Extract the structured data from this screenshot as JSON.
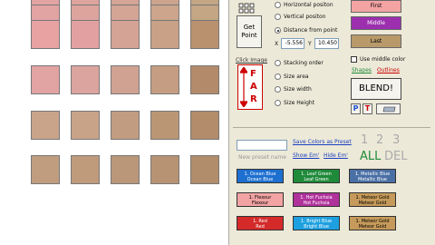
{
  "swatches": {
    "columns": 5,
    "colors": [
      [
        "#e2a3a3",
        "#dda49e",
        "#d4a495",
        "#cca58c",
        "#c4a584"
      ],
      [
        "#e8a2a2",
        "#e2a1a0",
        "#d4a395",
        "#c8a187",
        "#b9916e"
      ],
      [
        "#e2a3a3",
        "#dca49e",
        "#cfa292",
        "#c59d82",
        "#b38b6b"
      ],
      [
        "#c9a48a",
        "#c9a388",
        "#c29c80",
        "#bb9675",
        "#b38c6b"
      ],
      [
        "#c09d7f",
        "#bf9b7c",
        "#bb977a",
        "#b79373",
        "#b28d6c"
      ]
    ]
  },
  "panel": {
    "get_point_line1": "Get",
    "get_point_line2": "Point",
    "click_image_label": "Click Image",
    "far_letters": [
      "F",
      "A",
      "R"
    ],
    "radio_options": [
      {
        "label": "Horizontal positon",
        "selected": false
      },
      {
        "label": "Vertical positon",
        "selected": false
      },
      {
        "label": "Distance from point",
        "selected": true
      }
    ],
    "x_label": "X",
    "x_value": "-5.556",
    "y_label": "Y",
    "y_value": "10.450",
    "radio_options2": [
      {
        "label": "Stacking order",
        "selected": false
      },
      {
        "label": "Size area",
        "selected": false
      },
      {
        "label": "Size width",
        "selected": false
      },
      {
        "label": "Size Height",
        "selected": false
      }
    ],
    "first_label": "First",
    "middle_label": "Middle",
    "last_label": "Last",
    "use_middle_color": "Use middle color",
    "shapes_label": "Shapes",
    "outlines_label": "Outlines",
    "blend_label": "BLEND!",
    "p_label": "P",
    "t_label": "T",
    "save_colors_label": "Save Colors as Preset",
    "new_preset_placeholder": "New preset name",
    "show_em": "Show Em'",
    "hide_em": "Hide Em'",
    "num_1": "1",
    "num_2": "2",
    "num_3": "3",
    "all_label": "ALL",
    "del_label": "DEL",
    "colors": {
      "first": "#f4a3a3",
      "middle": "#9b2fae",
      "last": "#b89a6a",
      "accent": "#cc0000"
    }
  },
  "presets": [
    [
      {
        "l1": "1. Ocean Blue",
        "l2": "Ocean Blue",
        "color": "#1d6fd0",
        "dark": false
      },
      {
        "l1": "1. Leaf Green",
        "l2": "Leaf Green",
        "color": "#1f8a3a",
        "dark": false
      },
      {
        "l1": "1. Metallic Blue",
        "l2": "Metallic Blue",
        "color": "#4a6fa5",
        "dark": false
      }
    ],
    [
      {
        "l1": "1. Flexour",
        "l2": "Flexour",
        "color": "#f2a3a3",
        "dark": true
      },
      {
        "l1": "1. Hot Fuchsia",
        "l2": "Hot Fuchsia",
        "color": "#b0329b",
        "dark": false
      },
      {
        "l1": "1. Meteor Gold",
        "l2": "Meteor Gold",
        "color": "#c59a5a",
        "dark": true
      }
    ],
    [
      {
        "l1": "1. Red",
        "l2": "Red",
        "color": "#d42a2a",
        "dark": false
      },
      {
        "l1": "1. Bright Blue",
        "l2": "Bright Blue",
        "color": "#1ea0e0",
        "dark": false
      },
      {
        "l1": "1. Meteor Gold",
        "l2": "Meteor Gold",
        "color": "#c59a5a",
        "dark": true
      }
    ]
  ]
}
